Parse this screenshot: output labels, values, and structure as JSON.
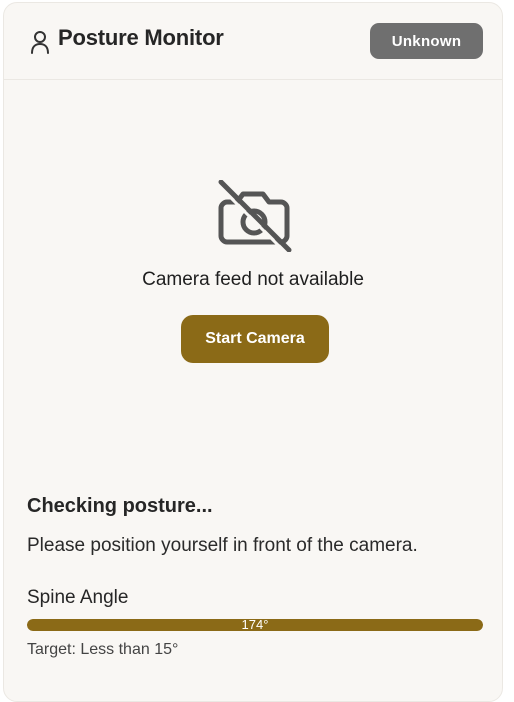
{
  "header": {
    "title": "Posture Monitor",
    "status_badge": "Unknown",
    "icon": "user-icon"
  },
  "camera": {
    "icon": "camera-off-icon",
    "message": "Camera feed not available",
    "start_button_label": "Start Camera"
  },
  "posture": {
    "status": "Checking posture...",
    "message": "Please position yourself in front of the camera."
  },
  "metric": {
    "label": "Spine Angle",
    "value": "174°",
    "fill_percent": 100,
    "target": "Target: Less than 15°"
  },
  "colors": {
    "accent": "#8b6a17",
    "badge": "#6f6f6f",
    "background": "#f9f7f4",
    "track": "#e5e0d6"
  }
}
